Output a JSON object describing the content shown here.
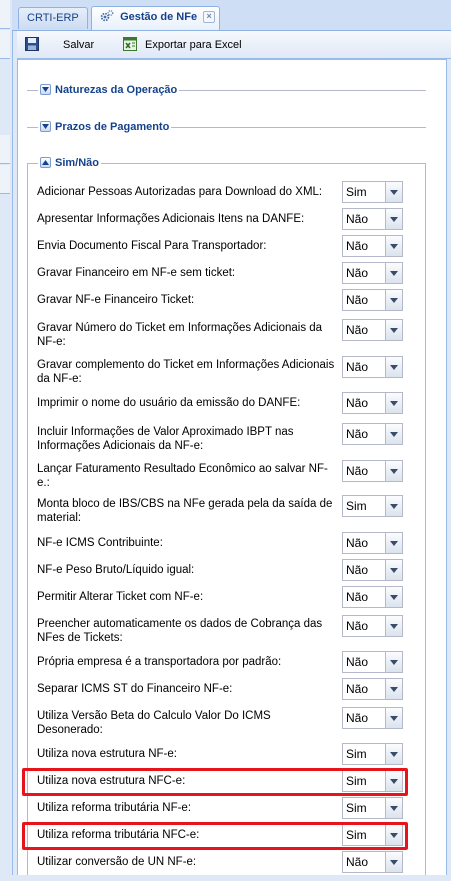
{
  "tabs": [
    {
      "label": "CRTI-ERP",
      "active": false
    },
    {
      "label": "Gestão de NFe",
      "active": true,
      "icon": "gear-icon",
      "closable": true
    }
  ],
  "toolbar": {
    "save_label": "Salvar",
    "export_label": "Exportar para Excel"
  },
  "sections": [
    {
      "title": "Naturezas da Operação",
      "collapsed": true
    },
    {
      "title": "Prazos de Pagamento",
      "collapsed": true
    },
    {
      "title": "Sim/Não",
      "collapsed": false
    }
  ],
  "settings": [
    {
      "label": "Adicionar Pessoas Autorizadas para Download do XML:",
      "value": "Sim"
    },
    {
      "label": "Apresentar Informações Adicionais Itens na DANFE:",
      "value": "Não"
    },
    {
      "label": "Envia Documento Fiscal Para Transportador:",
      "value": "Não"
    },
    {
      "label": "Gravar Financeiro em NF-e sem ticket:",
      "value": "Não"
    },
    {
      "label": "Gravar NF-e Financeiro Ticket:",
      "value": "Não"
    },
    {
      "label": "Gravar Número do Ticket em Informações Adicionais da NF-e:",
      "value": "Não"
    },
    {
      "label": "Gravar complemento do Ticket em Informações Adicionais da NF-e:",
      "value": "Não"
    },
    {
      "label": "Imprimir o nome do usuário da emissão do DANFE:",
      "value": "Não"
    },
    {
      "label": "Incluir Informações de Valor Aproximado IBPT nas Informações Adicionais da NF-e:",
      "value": "Não"
    },
    {
      "label": "Lançar Faturamento Resultado Econômico ao salvar NF-e.:",
      "value": "Não"
    },
    {
      "label": "Monta bloco de IBS/CBS na NFe gerada pela da saída de material:",
      "value": "Sim"
    },
    {
      "label": "NF-e ICMS Contribuinte:",
      "value": "Não"
    },
    {
      "label": "NF-e Peso Bruto/Líquido igual:",
      "value": "Não"
    },
    {
      "label": "Permitir Alterar Ticket com NF-e:",
      "value": "Não"
    },
    {
      "label": "Preencher automaticamente os dados de Cobrança das NFes de Tickets:",
      "value": "Não"
    },
    {
      "label": "Própria empresa é a transportadora por padrão:",
      "value": "Não"
    },
    {
      "label": "Separar ICMS ST do Financeiro NF-e:",
      "value": "Não"
    },
    {
      "label": "Utiliza Versão Beta do Calculo Valor Do ICMS Desonerado:",
      "value": "Não"
    },
    {
      "label": "Utiliza nova estrutura NF-e:",
      "value": "Sim"
    },
    {
      "label": "Utiliza nova estrutura NFC-e:",
      "value": "Sim",
      "highlighted": true
    },
    {
      "label": "Utiliza reforma tributária NF-e:",
      "value": "Sim"
    },
    {
      "label": "Utiliza reforma tributária NFC-e:",
      "value": "Sim",
      "highlighted": true
    },
    {
      "label": "Utilizar conversão de UN NF-e:",
      "value": "Não"
    }
  ],
  "colors": {
    "highlight": "#e8141b",
    "legend_text": "#15428b"
  }
}
